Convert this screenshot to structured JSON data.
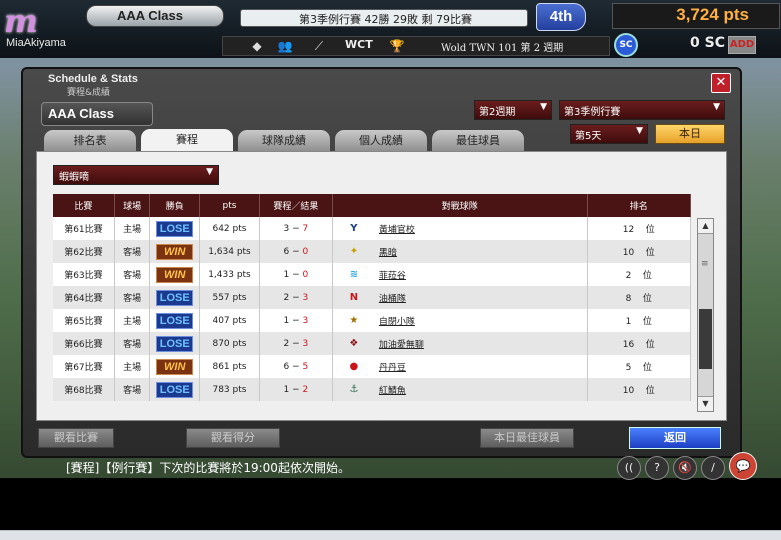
{
  "app": {
    "logo_text": "MiaAkiyama",
    "class_label": "AAA Class",
    "season_status": "第3季例行賽 42勝 29敗 剩 79比賽",
    "rank": "4th",
    "points": "3,724 pts",
    "toolbar_wct": "WCT",
    "world_text": "Wold TWN 101 第 2 週期",
    "sc_value": "0 SC",
    "add_label": "ADD"
  },
  "window": {
    "title": "Schedule & Stats",
    "subtitle": "賽程&成績",
    "class_label": "AAA Class",
    "close_label": "✕",
    "period_select": "第2週期",
    "season_select": "第3季例行賽",
    "day_select": "第5天",
    "today_button": "本日",
    "tabs": [
      {
        "label": "排名表"
      },
      {
        "label": "賽程"
      },
      {
        "label": "球隊成績"
      },
      {
        "label": "個人成績"
      },
      {
        "label": "最佳球員"
      }
    ],
    "filter_select": "蝦蝦嘀",
    "columns": [
      "比賽",
      "球場",
      "勝負",
      "pts",
      "賽程／結果",
      "對戰球隊",
      "排名"
    ],
    "rank_suffix": "位",
    "rows": [
      {
        "game": "第61比賽",
        "venue": "主場",
        "result": "LOSE",
        "pts": "642 pts",
        "score_l": "3",
        "score_r": "7",
        "opponent": "黃埔官校",
        "rank": "12"
      },
      {
        "game": "第62比賽",
        "venue": "客場",
        "result": "WIN",
        "pts": "1,634 pts",
        "score_l": "6",
        "score_r": "0",
        "opponent": "黑暗",
        "rank": "10"
      },
      {
        "game": "第63比賽",
        "venue": "客場",
        "result": "WIN",
        "pts": "1,433 pts",
        "score_l": "1",
        "score_r": "0",
        "opponent": "菲菈谷",
        "rank": "2"
      },
      {
        "game": "第64比賽",
        "venue": "客場",
        "result": "LOSE",
        "pts": "557 pts",
        "score_l": "2",
        "score_r": "3",
        "opponent": "油桶隊",
        "rank": "8"
      },
      {
        "game": "第65比賽",
        "venue": "主場",
        "result": "LOSE",
        "pts": "407 pts",
        "score_l": "1",
        "score_r": "3",
        "opponent": "自閉小隊",
        "rank": "1"
      },
      {
        "game": "第66比賽",
        "venue": "客場",
        "result": "LOSE",
        "pts": "870 pts",
        "score_l": "2",
        "score_r": "3",
        "opponent": "加油愛無聊",
        "rank": "16"
      },
      {
        "game": "第67比賽",
        "venue": "主場",
        "result": "WIN",
        "pts": "861 pts",
        "score_l": "6",
        "score_r": "5",
        "opponent": "丹丹豆",
        "rank": "5"
      },
      {
        "game": "第68比賽",
        "venue": "客場",
        "result": "LOSE",
        "pts": "783 pts",
        "score_l": "1",
        "score_r": "2",
        "opponent": "紅鯖魚",
        "rank": "10"
      }
    ],
    "buttons": {
      "view_game": "觀看比賽",
      "view_score": "觀看得分",
      "today_mvp": "本日最佳球員",
      "back": "返回"
    }
  },
  "ticker": "[賽程]【例行賽】下次的比賽將於19:00起依次開始。",
  "controls": {
    "rewind": "((",
    "help": "?",
    "mute": "🔇",
    "slash": "/",
    "chat": "💬"
  }
}
